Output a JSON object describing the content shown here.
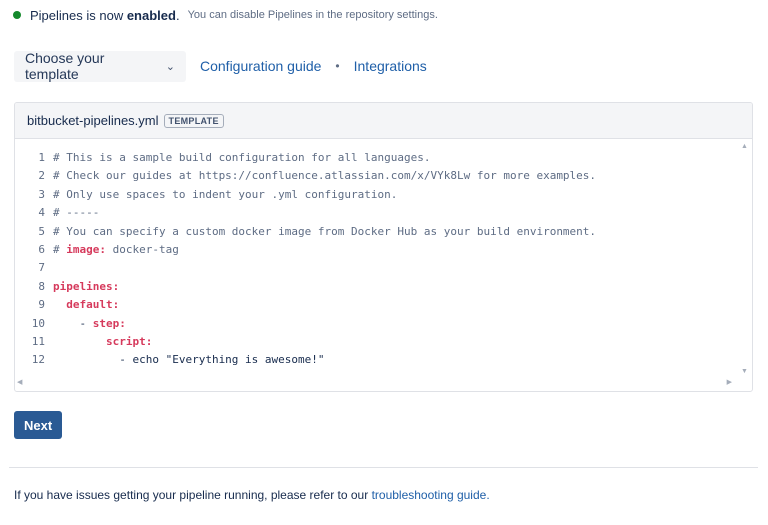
{
  "status": {
    "prefix": "Pipelines is now ",
    "emphasis": "enabled",
    "suffix": ".",
    "note": "You can disable Pipelines in the repository settings.",
    "dot_color": "#14892c"
  },
  "toolbar": {
    "template_select_label": "Choose your template",
    "config_guide_link": "Configuration guide",
    "separator": "•",
    "integrations_link": "Integrations"
  },
  "editor": {
    "filename": "bitbucket-pipelines.yml",
    "badge": "TEMPLATE",
    "line_numbers": [
      "1",
      "2",
      "3",
      "4",
      "5",
      "6",
      "7",
      "8",
      "9",
      "10",
      "11",
      "12"
    ],
    "lines": [
      [
        {
          "cls": "c-comment",
          "text": "# This is a sample build configuration for all languages."
        }
      ],
      [
        {
          "cls": "c-comment",
          "text": "# Check our guides at https://confluence.atlassian.com/x/VYk8Lw for more examples."
        }
      ],
      [
        {
          "cls": "c-comment",
          "text": "# Only use spaces to indent your .yml configuration."
        }
      ],
      [
        {
          "cls": "c-comment",
          "text": "# -----"
        }
      ],
      [
        {
          "cls": "c-comment",
          "text": "# You can specify a custom docker image from Docker Hub as your build environment."
        }
      ],
      [
        {
          "cls": "c-comment",
          "text": "# "
        },
        {
          "cls": "c-key",
          "text": "image:"
        },
        {
          "cls": "c-comment",
          "text": " docker-tag"
        }
      ],
      [
        {
          "cls": "c-plain",
          "text": ""
        }
      ],
      [
        {
          "cls": "c-key",
          "text": "pipelines:"
        }
      ],
      [
        {
          "cls": "c-plain",
          "text": "  "
        },
        {
          "cls": "c-key",
          "text": "default:"
        }
      ],
      [
        {
          "cls": "c-plain",
          "text": "    - "
        },
        {
          "cls": "c-key",
          "text": "step:"
        }
      ],
      [
        {
          "cls": "c-plain",
          "text": "        "
        },
        {
          "cls": "c-key",
          "text": "script:"
        }
      ],
      [
        {
          "cls": "c-plain",
          "text": "          - echo \"Everything is awesome!\""
        }
      ]
    ]
  },
  "actions": {
    "next_label": "Next"
  },
  "footer": {
    "text": "If you have issues getting your pipeline running, please refer to our ",
    "link": "troubleshooting guide."
  },
  "colors": {
    "link": "#1f5fa8",
    "primary_button": "#2a5a94",
    "yaml_key": "#d63a5c"
  }
}
